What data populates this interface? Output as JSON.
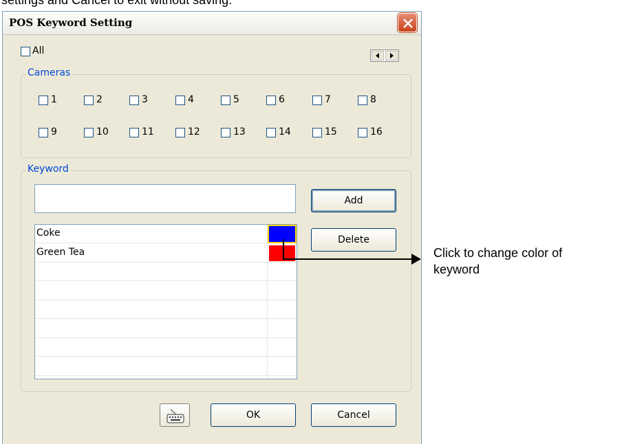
{
  "top_caption": "settings and Cancel to exit without saving.",
  "window": {
    "title": "POS Keyword Setting",
    "close_icon": "close-icon"
  },
  "all_checkbox": {
    "label": "All",
    "checked": false
  },
  "cameras": {
    "title": "Cameras",
    "items": [
      {
        "label": "1"
      },
      {
        "label": "2"
      },
      {
        "label": "3"
      },
      {
        "label": "4"
      },
      {
        "label": "5"
      },
      {
        "label": "6"
      },
      {
        "label": "7"
      },
      {
        "label": "8"
      },
      {
        "label": "9"
      },
      {
        "label": "10"
      },
      {
        "label": "11"
      },
      {
        "label": "12"
      },
      {
        "label": "13"
      },
      {
        "label": "14"
      },
      {
        "label": "15"
      },
      {
        "label": "16"
      }
    ]
  },
  "keyword": {
    "title": "Keyword",
    "input_value": "",
    "add_label": "Add",
    "delete_label": "Delete",
    "list": [
      {
        "text": "Coke",
        "color": "#0000ff",
        "selected": true
      },
      {
        "text": "Green Tea",
        "color": "#ff0000",
        "selected": false
      }
    ]
  },
  "buttons": {
    "keyboard_icon": "keyboard-icon",
    "ok_label": "OK",
    "cancel_label": "Cancel"
  },
  "annotation": {
    "line1": "Click to change color of",
    "line2": "keyword"
  }
}
